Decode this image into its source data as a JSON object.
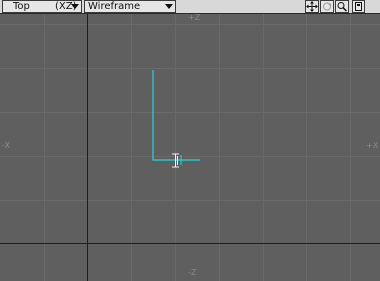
{
  "toolbar": {
    "view_mode": "Top",
    "view_axis": "(XZ)",
    "render_mode": "Wireframe",
    "icons": [
      "move-view-icon",
      "rotate-view-icon",
      "zoom-view-icon",
      "maximize-viewport-icon"
    ]
  },
  "viewport": {
    "axis_labels": {
      "top": "+Z",
      "bottom": "-Z",
      "left": "-X",
      "right": "+X"
    },
    "colors": {
      "background": "#5f5f5f",
      "grid_minor": "#6a6a6a",
      "grid_major": "#1e1e1e",
      "selection": "#1fd6e0"
    }
  }
}
